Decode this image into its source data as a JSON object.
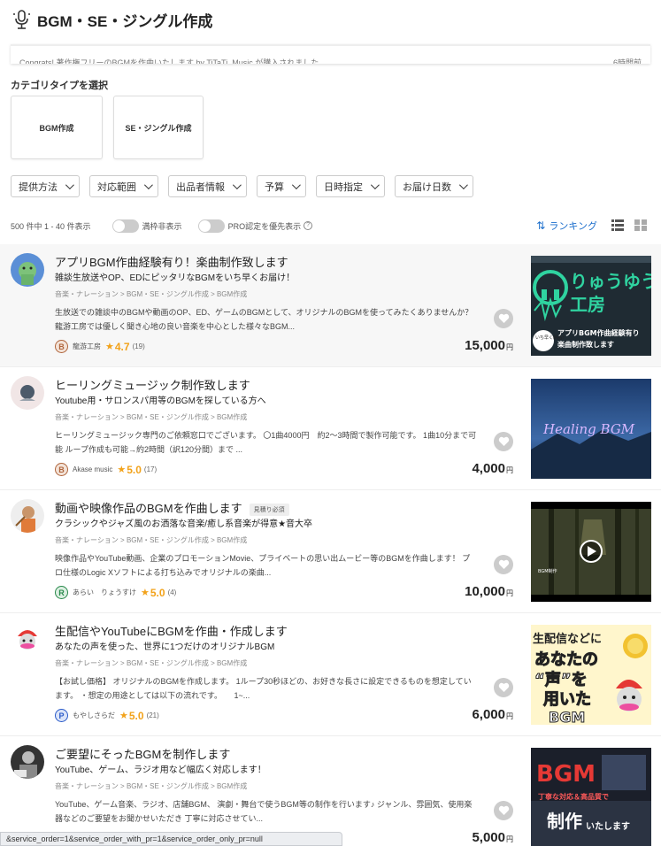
{
  "header": {
    "title": "BGM・SE・ジングル作成"
  },
  "toast": {
    "text": "Congrats! 著作権フリーのBGMを作曲いたします by TiTaTi_Music が購入されました",
    "time": "6時間前"
  },
  "category": {
    "heading": "カテゴリタイプを選択",
    "cards": [
      "BGM作成",
      "SE・ジングル作成"
    ]
  },
  "filters": [
    "提供方法",
    "対応範囲",
    "出品者情報",
    "予算",
    "日時指定",
    "お届け日数"
  ],
  "results": {
    "count_text": "500 件中 1 - 40 件表示",
    "toggle1": "満枠非表示",
    "toggle2": "PRO認定を優先表示",
    "help": "?",
    "ranking": "ランキング"
  },
  "items": [
    {
      "title": "アプリBGM作曲経験有り！楽曲制作致します",
      "badge": "",
      "subtitle": "雑談生放送やOP、EDにピッタリなBGMをいち早くお届け！",
      "crumb": "音楽・ナレーション > BGM・SE・ジングル作成 > BGM作成",
      "desc": "生放送での雑談中のBGMや動画のOP、ED、ゲームのBGMとして、オリジナルのBGMを使ってみたくありませんか？ 龍游工房では優しく聞き心地の良い音楽を中心とした様々なBGM...",
      "rank": "B",
      "rank_class": "b",
      "seller": "龍游工房",
      "score": "4.7",
      "count": "(19)",
      "price": "15,000",
      "yen": "円",
      "thumb_text": [
        "りゅうゆう",
        "工房",
        "いち早く納品！",
        "アプリBGM作曲経験有り",
        "楽曲制作致します"
      ]
    },
    {
      "title": "ヒーリングミュージック制作致します",
      "badge": "",
      "subtitle": "Youtube用・サロンスパ用等のBGMを探している方へ",
      "crumb": "音楽・ナレーション > BGM・SE・ジングル作成 > BGM作成",
      "desc": "ヒーリングミュージック専門のご依頼窓口でございます。 〇1曲4000円　約2～3時間で製作可能です。 1曲10分まで可能 ループ作成も可能→約2時間（訳120分間）まで ...",
      "rank": "B",
      "rank_class": "b",
      "seller": "Akase music",
      "score": "5.0",
      "count": "(17)",
      "price": "4,000",
      "yen": "円",
      "thumb_text": [
        "Healing BGM"
      ]
    },
    {
      "title": "動画や映像作品のBGMを作曲します",
      "badge": "見積り必須",
      "subtitle": "クラシックやジャズ風のお洒落な音楽/癒し系音楽が得意★音大卒",
      "crumb": "音楽・ナレーション > BGM・SE・ジングル作成 > BGM作成",
      "desc": "映像作品やYouTube動画、企業のプロモーションMovie、プライベートの思い出ムービー等のBGMを作曲します！ プロ仕様のLogic Xソフトによる打ち込みでオリジナルの楽曲...",
      "rank": "R",
      "rank_class": "r",
      "seller": "あらい　りょうすけ",
      "score": "5.0",
      "count": "(4)",
      "price": "10,000",
      "yen": "円",
      "thumb_text": [
        "BGM制作"
      ]
    },
    {
      "title": "生配信やYouTubeにBGMを作曲・作成します",
      "badge": "",
      "subtitle": "あなたの声を使った、世界に1つだけのオリジナルBGM",
      "crumb": "音楽・ナレーション > BGM・SE・ジングル作成 > BGM作成",
      "desc": "【お試し価格】 オリジナルのBGMを作成します。 1ループ30秒ほどの、お好きな長さに設定できるものを想定しています。 ・想定の用途としては以下の流れです。　　1~...",
      "rank": "P",
      "rank_class": "p",
      "seller": "もやしさらだ",
      "score": "5.0",
      "count": "(21)",
      "price": "6,000",
      "yen": "円",
      "thumb_text": [
        "生配信などに",
        "あなたの",
        "“声”を",
        "用いた",
        "BGM"
      ]
    },
    {
      "title": "ご要望にそったBGMを制作します",
      "badge": "",
      "subtitle": "YouTube、ゲーム、ラジオ用など幅広く対応します！",
      "crumb": "音楽・ナレーション > BGM・SE・ジングル作成 > BGM作成",
      "desc": "YouTube、ゲーム音楽、ラジオ、店舗BGM、 演劇・舞台で使うBGM等の制作を行います♪ ジャンル、雰囲気、使用楽器などのご要望をお聞かせいただき 丁寧に対応させてい...",
      "rank": "",
      "rank_class": "",
      "seller": "",
      "score": "",
      "count": "",
      "price": "5,000",
      "yen": "円",
      "thumb_text": [
        "BGM",
        "丁寧な対応＆高品質で",
        "制作",
        "いたします"
      ]
    }
  ],
  "status_url": "&service_order=1&service_order_with_pr=1&service_order_only_pr=null"
}
